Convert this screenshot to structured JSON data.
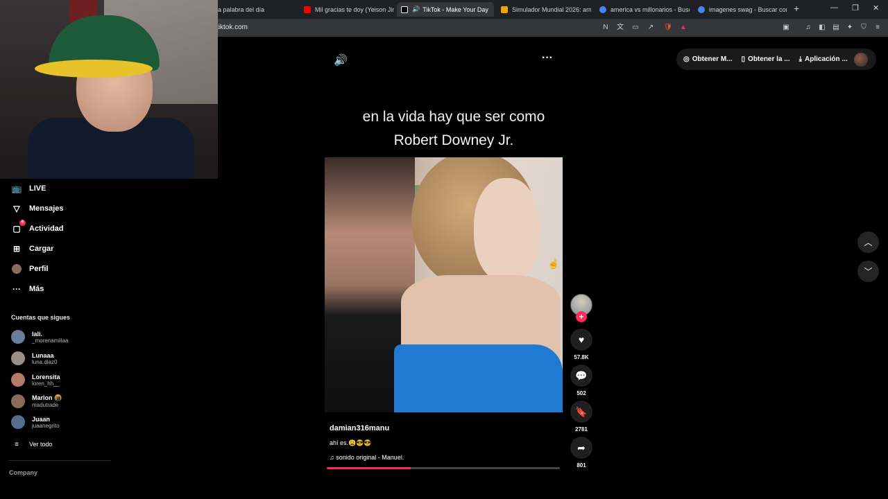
{
  "browser": {
    "tabs": [
      {
        "label": "a palabra del día",
        "color": "#888888"
      },
      {
        "label": "Mil gracias te doy (Yeison Jimé",
        "color": "#ff0000"
      },
      {
        "label": "TikTok - Make Your Day",
        "color": "#ffffff",
        "active": true
      },
      {
        "label": "Simulador Mundial 2026: armá",
        "color": "#f2a100"
      },
      {
        "label": "america vs millonarios - Busca",
        "color": "#4285f4"
      },
      {
        "label": "imagenes swag - Buscar con G",
        "color": "#4285f4"
      }
    ],
    "new_tab": "+",
    "url": "tiktok.com"
  },
  "sidebar": {
    "items": [
      {
        "label": "LIVE",
        "icon": "live-tv-icon"
      },
      {
        "label": "Mensajes",
        "icon": "paper-plane-icon"
      },
      {
        "label": "Actividad",
        "icon": "inbox-icon",
        "badge": "6"
      },
      {
        "label": "Cargar",
        "icon": "plus-square-icon"
      },
      {
        "label": "Perfil",
        "icon": "profile-avatar"
      },
      {
        "label": "Más",
        "icon": "more-dots-icon"
      }
    ],
    "following_title": "Cuentas que sigues",
    "following": [
      {
        "name": "lali.",
        "user": "_morenamiilaa",
        "color": "#6a7d9a"
      },
      {
        "name": "Lunaaa",
        "user": "luna.diaz0",
        "color": "#9a8f86"
      },
      {
        "name": "Lorensita",
        "user": "loren_hh__",
        "color": "#b47a6a"
      },
      {
        "name": "Marlon 🍘",
        "user": "madutrade",
        "color": "#8a6a5a"
      },
      {
        "name": "Juaan",
        "user": "juaanegrito",
        "color": "#5a6a8a"
      }
    ],
    "see_all": "Ver todo",
    "company": "Company"
  },
  "video": {
    "overlay_text_line1": "en la vida hay que ser como",
    "overlay_text_line2": "Robert Downey Jr.",
    "author": "damian316manu",
    "caption": "ahí es.😩😎😎",
    "sound": "sonido original - Manuel.",
    "progress": 0.36
  },
  "actions": {
    "likes": "57.8K",
    "comments": "502",
    "saves": "2781",
    "shares": "801"
  },
  "header": {
    "get_coins": "Obtener M...",
    "get_app": "Obtener la ...",
    "app": "Aplicación ..."
  },
  "colors": {
    "accent": "#fe2c55",
    "background": "#000000"
  }
}
